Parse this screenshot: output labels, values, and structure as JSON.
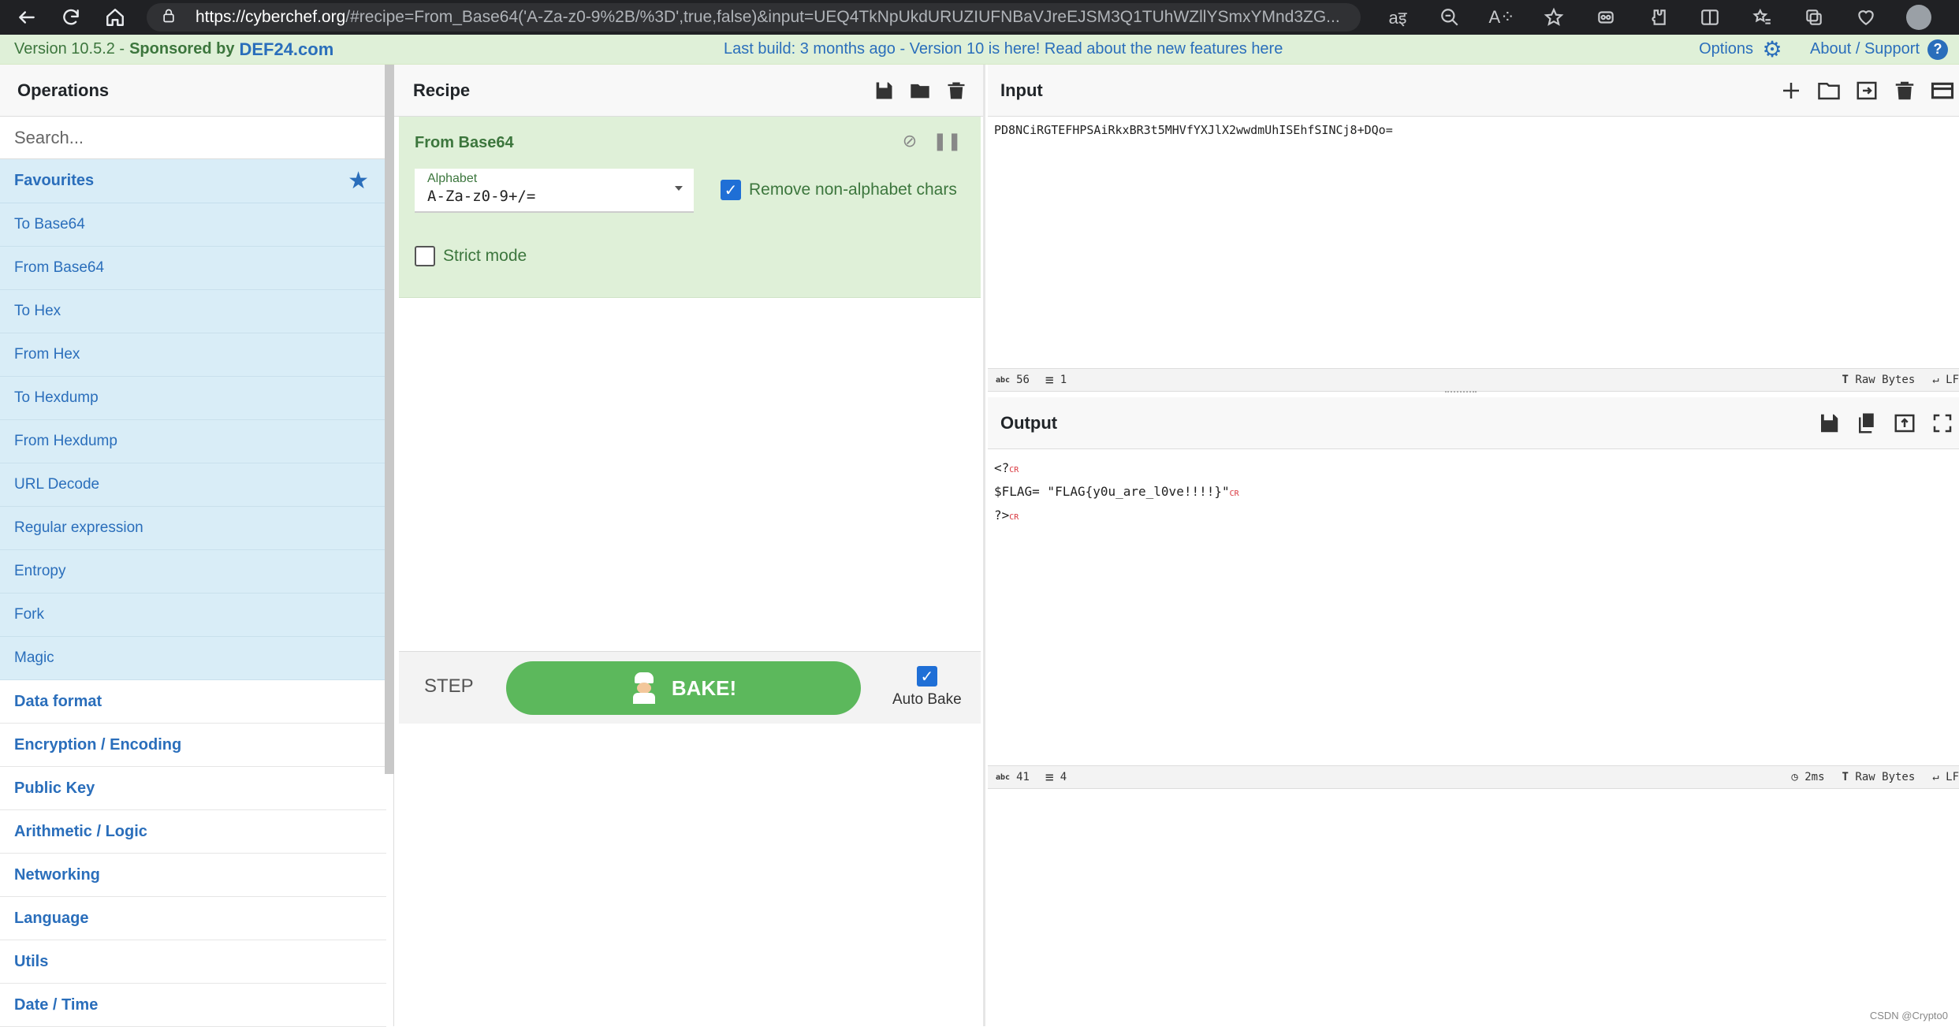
{
  "browser": {
    "url_host": "https://cyberchef.org",
    "url_rest": "/#recipe=From_Base64('A-Za-z0-9%2B/%3D',true,false)&input=UEQ4TkNpUkdURUZIUFNBaVJreEJSM3Q1TUhWZllYSmxYMnd3ZG..."
  },
  "banner": {
    "version": "Version 10.5.2 -",
    "sponsored": "Sponsored by",
    "sponsor": "DEF24.com",
    "center_text": "Last build: 3 months ago - Version 10 is here! Read about the new features",
    "center_link": "here",
    "options": "Options",
    "about": "About / Support"
  },
  "operations": {
    "title": "Operations",
    "search_placeholder": "Search...",
    "favourites_label": "Favourites",
    "favourites": [
      "To Base64",
      "From Base64",
      "To Hex",
      "From Hex",
      "To Hexdump",
      "From Hexdump",
      "URL Decode",
      "Regular expression",
      "Entropy",
      "Fork",
      "Magic"
    ],
    "categories": [
      "Data format",
      "Encryption / Encoding",
      "Public Key",
      "Arithmetic / Logic",
      "Networking",
      "Language",
      "Utils",
      "Date / Time"
    ]
  },
  "recipe": {
    "title": "Recipe",
    "op_name": "From Base64",
    "alphabet_label": "Alphabet",
    "alphabet_value": "A-Za-z0-9+/=",
    "remove_label": "Remove non-alphabet chars",
    "remove_checked": true,
    "strict_label": "Strict mode",
    "strict_checked": false,
    "step_label": "STEP",
    "bake_label": "BAKE!",
    "auto_bake_label": "Auto Bake",
    "auto_bake_checked": true
  },
  "input": {
    "title": "Input",
    "text": "PD8NCiRGTEFHPSAiRkxBR3t5MHVfYXJlX2wwdmUhISEhfSINCj8+DQo=",
    "chars": "56",
    "lines": "1",
    "raw_bytes": "Raw Bytes",
    "eol": "LF"
  },
  "output": {
    "title": "Output",
    "line1": "<?",
    "line2": "$FLAG= \"FLAG{y0u_are_l0ve!!!!}\"",
    "line3": "?>",
    "cr_marker": "CR",
    "chars": "41",
    "lines": "4",
    "time": "2ms",
    "raw_bytes": "Raw Bytes",
    "eol": "LF"
  },
  "watermark": "CSDN @Crypto0"
}
